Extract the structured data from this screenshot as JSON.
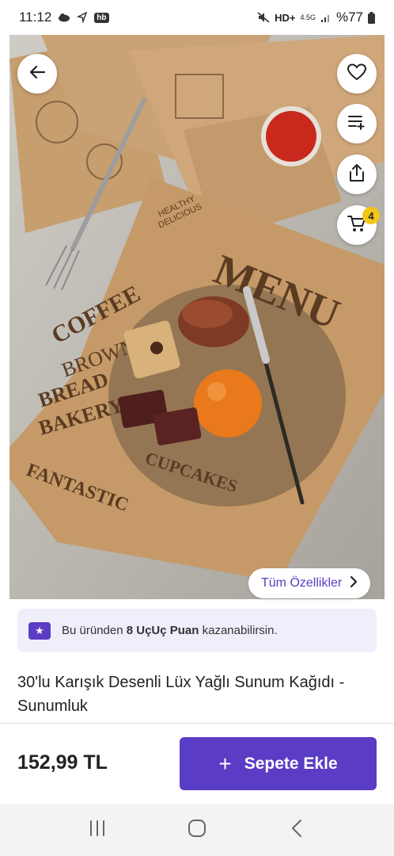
{
  "status_bar": {
    "time": "11:12",
    "network": "HD+",
    "network_gen": "4.5G",
    "battery": "%77",
    "app_badge": "hb",
    "icons": [
      "cloud-icon",
      "location-icon",
      "hb-app-icon",
      "mute-icon",
      "signal-icon",
      "battery-icon"
    ]
  },
  "product": {
    "all_features_label": "Tüm Özellikler",
    "cart_count": "4",
    "title": "30'lu Karışık Desenli Lüx Yağlı Sunum Kağıdı - Sunumluk",
    "price": "152,99 TL",
    "add_to_cart_label": "Sepete Ekle"
  },
  "points_banner": {
    "prefix": "Bu üründen ",
    "highlight": "8 UçUç Puan",
    "suffix": " kazanabilirsin."
  },
  "image_text": {
    "menu": "MENU",
    "coffee": "COFFEE",
    "brownie": "BROWNIE",
    "bread": "BREAD",
    "bakery": "BAKERY",
    "fantastic": "FANTASTIC",
    "cupcakes": "CUPCAKES",
    "healthy": "HEALTHY",
    "delicious": "DELICIOUS"
  },
  "colors": {
    "accent": "#5b3cc4",
    "badge": "#f5c518",
    "banner_bg": "#f0eefa"
  }
}
